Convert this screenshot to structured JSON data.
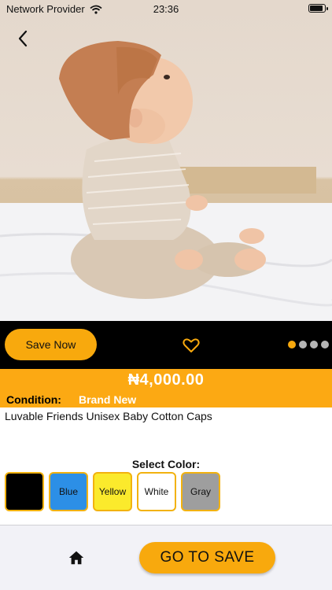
{
  "status_bar": {
    "carrier": "Network Provider",
    "time": "23:36"
  },
  "product_image": {
    "alt": "Luvable Friends Unisex Baby Cotton Caps"
  },
  "actions": {
    "save_now_label": "Save Now"
  },
  "carousel": {
    "total": 4,
    "active_index": 0
  },
  "price": {
    "amount": "₦4,000.00"
  },
  "condition": {
    "label": "Condition:",
    "value": "Brand New"
  },
  "product": {
    "title": "Luvable Friends Unisex Baby Cotton Caps"
  },
  "color_picker": {
    "heading": "Select Color:",
    "options": [
      {
        "label": "",
        "color": "#000000"
      },
      {
        "label": "Blue",
        "color": "#2c8fe6"
      },
      {
        "label": "Yellow",
        "color": "#fbea2c"
      },
      {
        "label": "White",
        "color": "#ffffff"
      },
      {
        "label": "Gray",
        "color": "#9e9e9e"
      }
    ]
  },
  "bottom_nav": {
    "go_to_save_label": "GO TO SAVE"
  },
  "colors": {
    "accent": "#f8a90d",
    "price_bar": "#fca913",
    "action_bar": "#000000"
  }
}
